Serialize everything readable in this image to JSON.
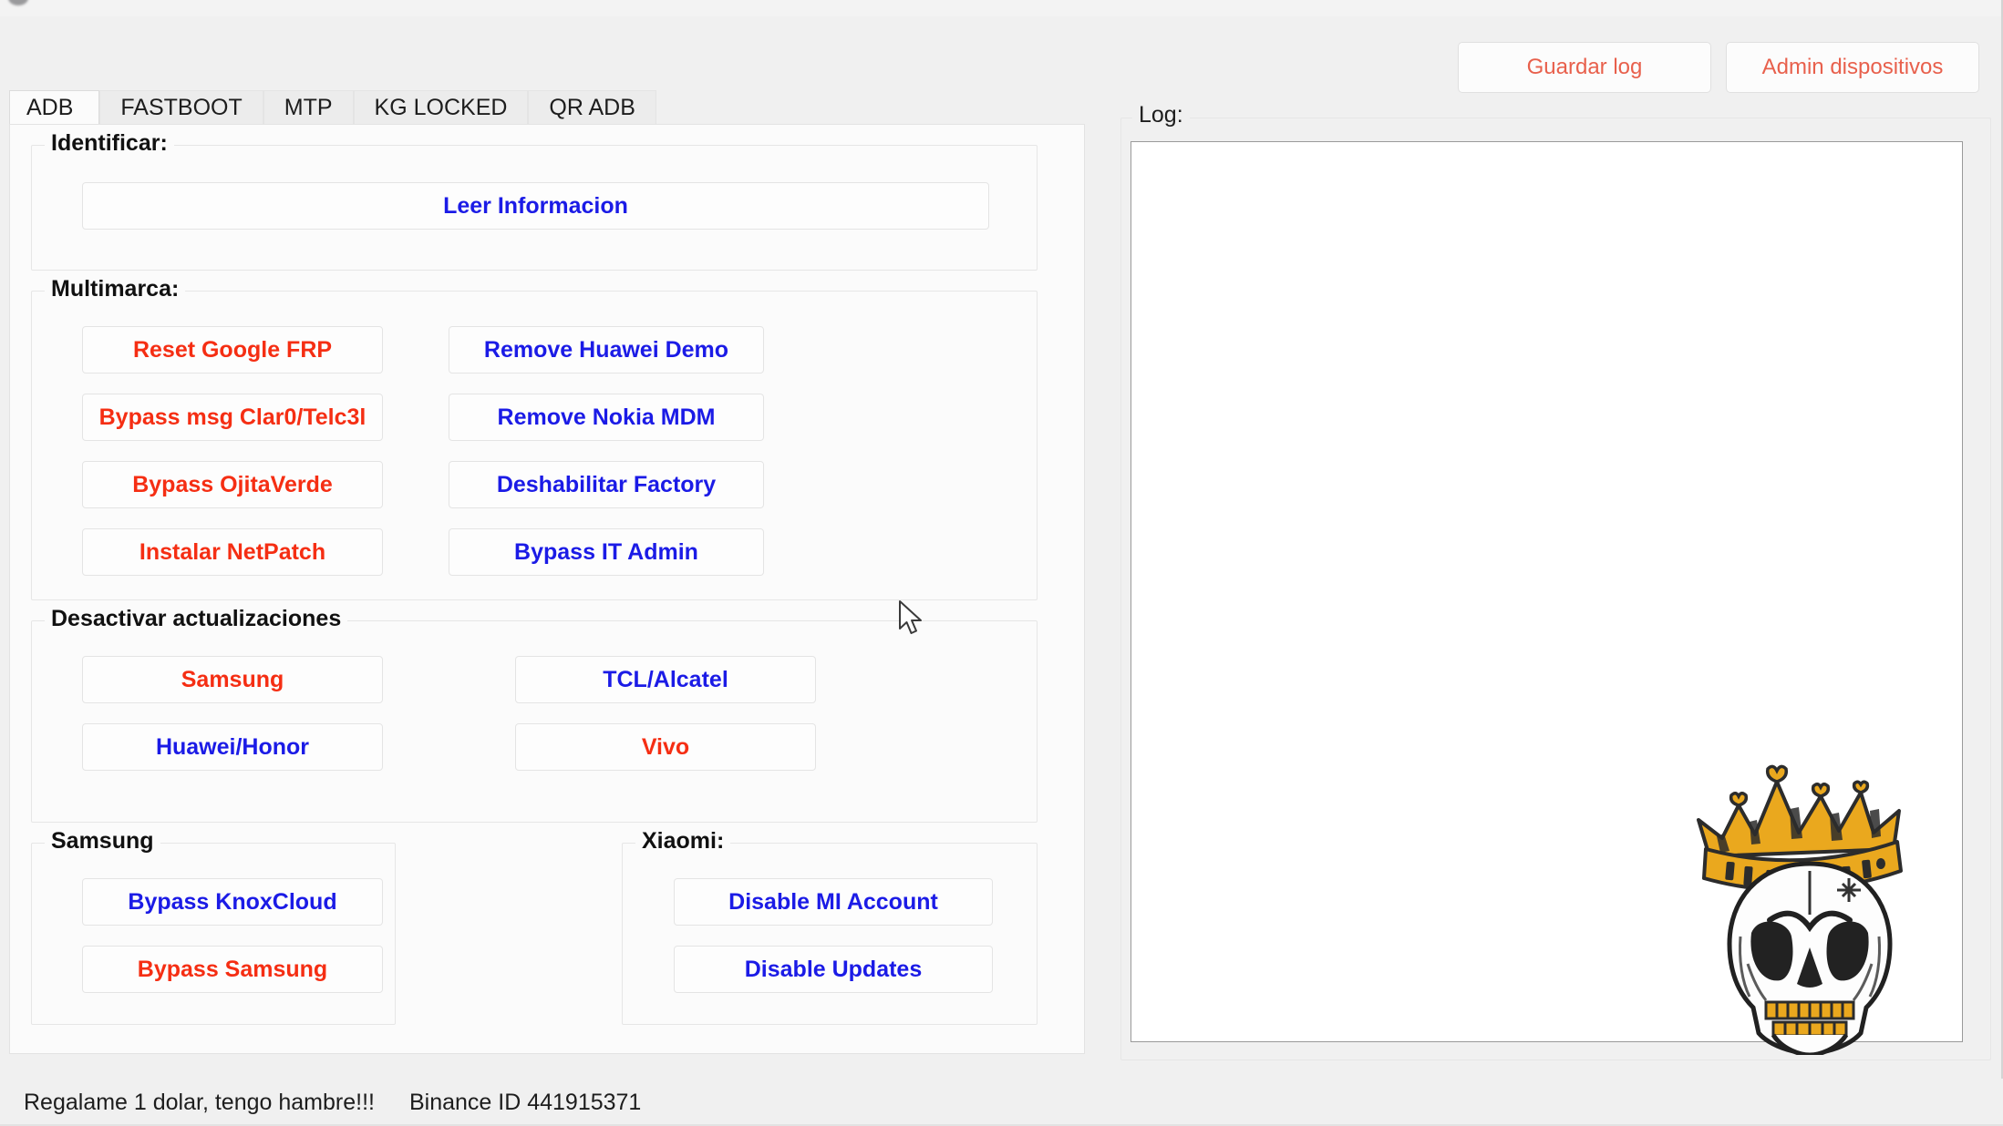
{
  "window": {
    "toolbar_buttons": [
      {
        "label": "Guardar log",
        "name": "guardar-log-button"
      },
      {
        "label": "Admin dispositivos",
        "name": "admin-dispositivos-button"
      }
    ]
  },
  "tabs": [
    {
      "label": "ADB",
      "active": true
    },
    {
      "label": "FASTBOOT",
      "active": false
    },
    {
      "label": "MTP",
      "active": false
    },
    {
      "label": "KG LOCKED",
      "active": false
    },
    {
      "label": "QR ADB",
      "active": false
    }
  ],
  "groups": {
    "identificar": {
      "title": "Identificar:",
      "buttons": [
        {
          "label": "Leer Informacion",
          "color": "blue"
        }
      ]
    },
    "multimarca": {
      "title": "Multimarca:",
      "left_buttons": [
        {
          "label": "Reset Google FRP",
          "color": "red"
        },
        {
          "label": "Bypass msg Clar0/Telc3l",
          "color": "red"
        },
        {
          "label": "Bypass OjitaVerde",
          "color": "red"
        },
        {
          "label": "Instalar NetPatch",
          "color": "red"
        }
      ],
      "right_buttons": [
        {
          "label": "Remove Huawei Demo",
          "color": "blue"
        },
        {
          "label": "Remove Nokia MDM",
          "color": "blue"
        },
        {
          "label": "Deshabilitar Factory",
          "color": "blue"
        },
        {
          "label": "Bypass IT Admin",
          "color": "blue"
        }
      ]
    },
    "desactivar": {
      "title": "Desactivar actualizaciones",
      "left_buttons": [
        {
          "label": "Samsung",
          "color": "red"
        },
        {
          "label": "Huawei/Honor",
          "color": "blue"
        }
      ],
      "right_buttons": [
        {
          "label": "TCL/Alcatel",
          "color": "blue"
        },
        {
          "label": "Vivo",
          "color": "red"
        }
      ]
    },
    "samsung": {
      "title": "Samsung",
      "buttons": [
        {
          "label": "Bypass KnoxCloud",
          "color": "blue"
        },
        {
          "label": "Bypass Samsung",
          "color": "red"
        }
      ]
    },
    "xiaomi": {
      "title": "Xiaomi:",
      "buttons": [
        {
          "label": "Disable MI Account",
          "color": "blue"
        },
        {
          "label": "Disable Updates",
          "color": "blue"
        }
      ]
    }
  },
  "log": {
    "title": "Log:",
    "content": ""
  },
  "statusbar": {
    "donation_text": "Regalame 1 dolar, tengo hambre!!!",
    "binance_text": "Binance ID 441915371"
  },
  "colors": {
    "red": "#f52e13",
    "blue": "#1b1be6",
    "toolbar_accent": "#e8604c",
    "crown_gold": "#eaa81e",
    "panel_bg": "#fbfbfb",
    "window_bg": "#f0f0f0"
  },
  "branding": {
    "logo": "crowned-skull-logo"
  }
}
